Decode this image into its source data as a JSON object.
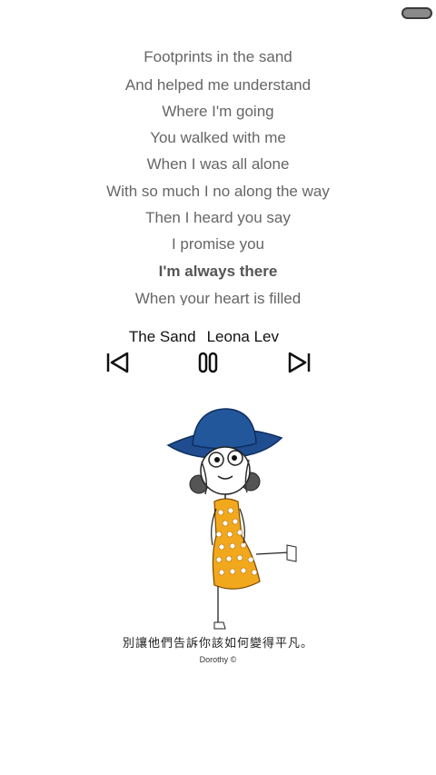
{
  "lyrics": {
    "lines": [
      "Footprints in the sand",
      "And helped me understand",
      "Where I'm going",
      "You walked with me",
      "When I was all alone",
      "With so much I no along the way",
      "Then I heard you say",
      "I promise you",
      "I'm always there",
      "When your heart is filled"
    ],
    "current_line": "I'm always there"
  },
  "player": {
    "song_title_visible": "n The Sand",
    "artist_visible": "Leona Lev",
    "prev_icon": "skip-previous-icon",
    "pause_icon": "pause-icon",
    "next_icon": "skip-next-icon"
  },
  "artwork": {
    "caption": "別讓他們告訴你該如何變得平凡。",
    "credit": "Dorothy ©",
    "colors": {
      "hat": "#1f4d8f",
      "dress": "#f2a81d",
      "dots": "#ffffff"
    }
  }
}
